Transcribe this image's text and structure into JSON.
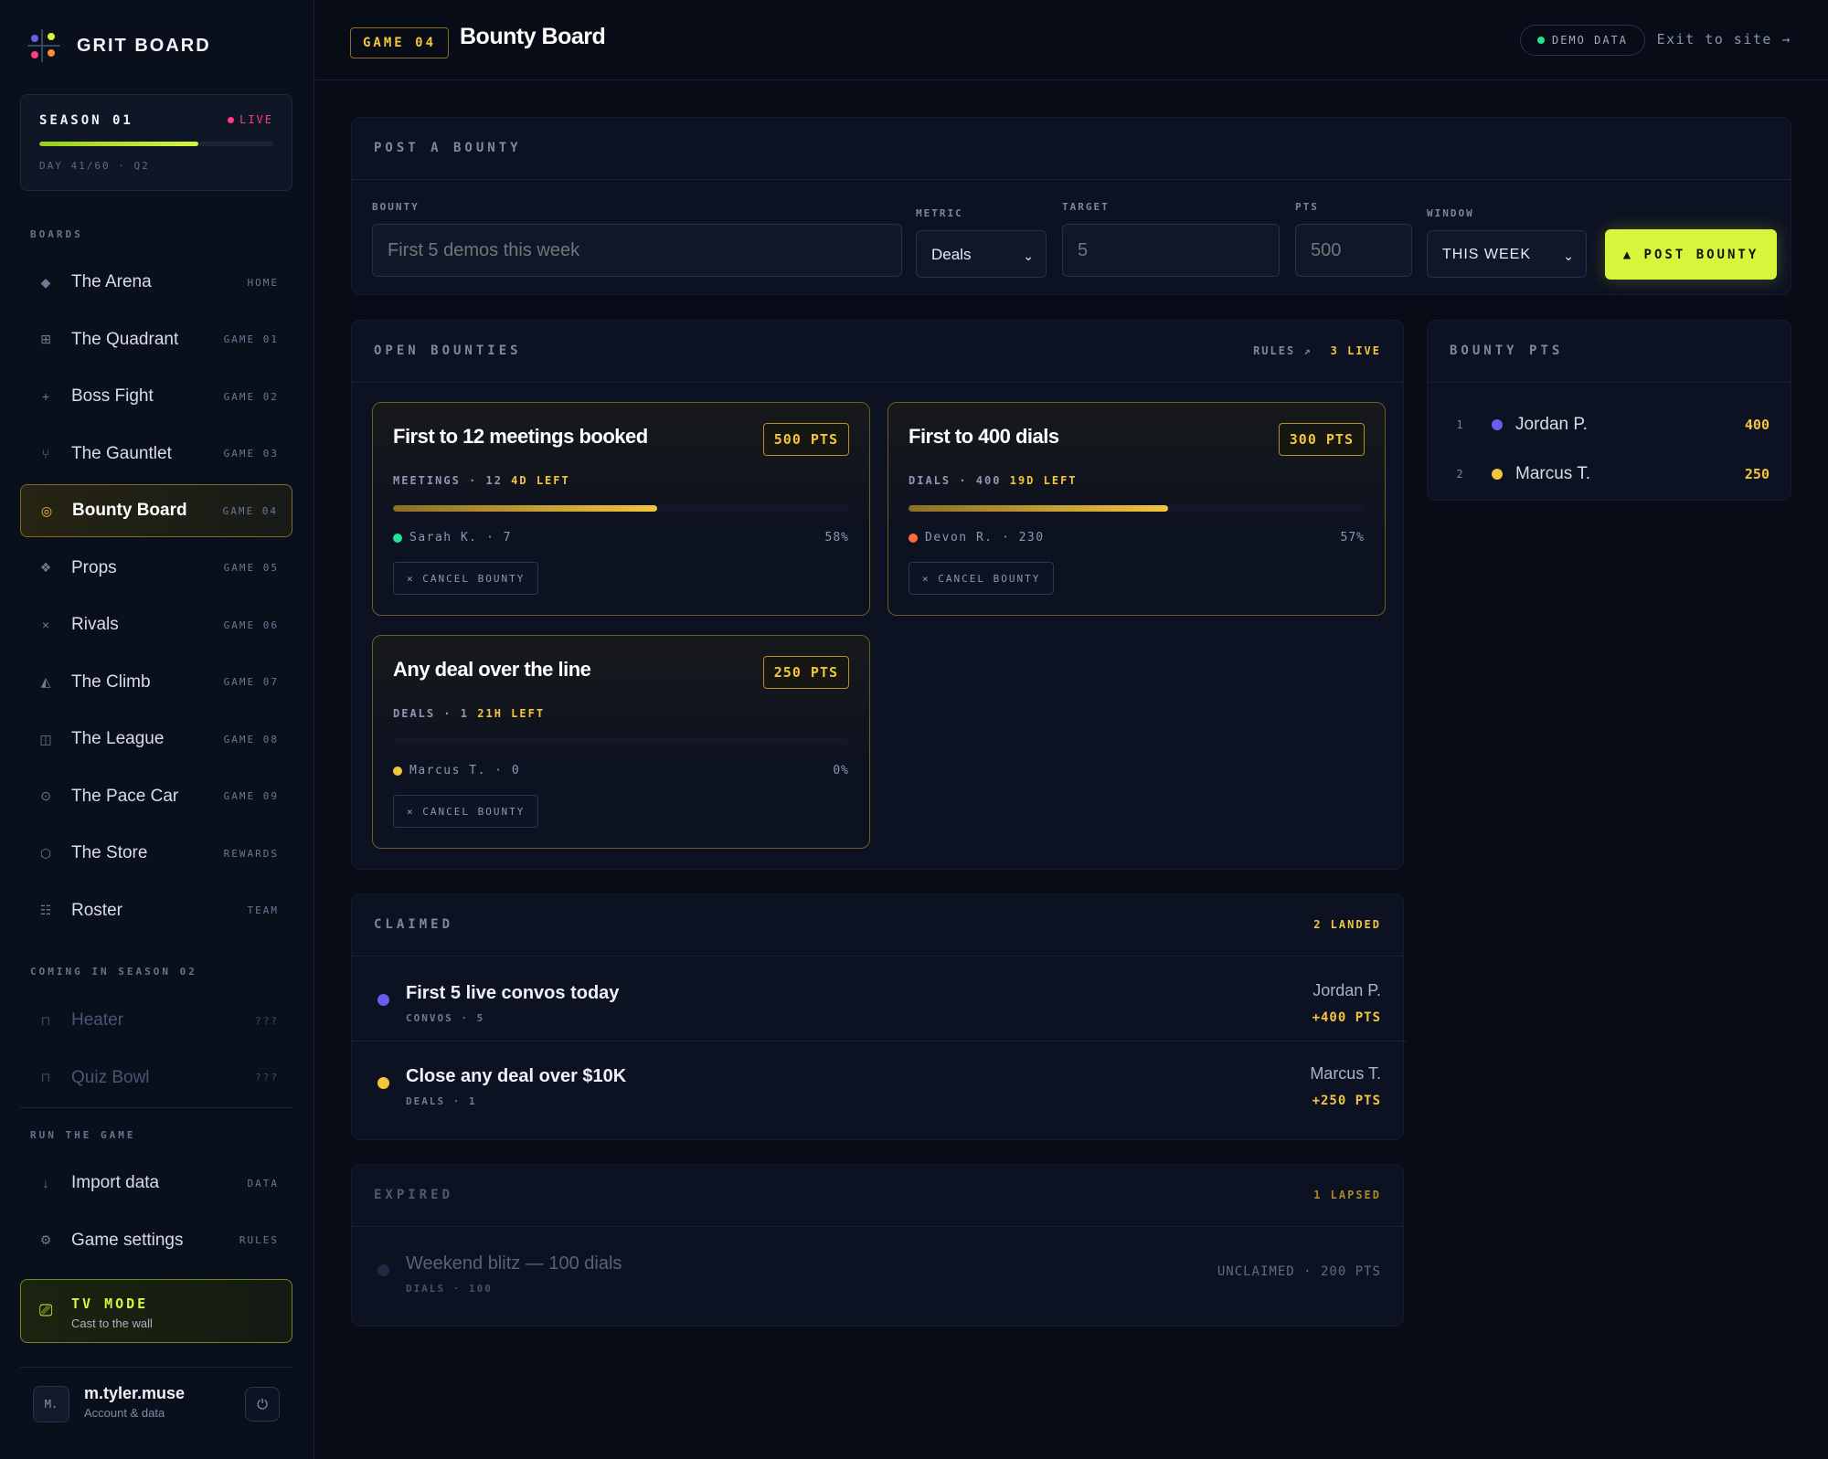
{
  "brand": {
    "name": "GRIT BOARD"
  },
  "season": {
    "title": "SEASON 01",
    "live_label": "LIVE",
    "progress": 0.68,
    "sub": "DAY 41/60 · Q2"
  },
  "sidebar": {
    "boards_label": "BOARDS",
    "items": [
      {
        "label": "The Arena",
        "tag": "HOME",
        "icon": "◆"
      },
      {
        "label": "The Quadrant",
        "tag": "GAME 01",
        "icon": "⊞"
      },
      {
        "label": "Boss Fight",
        "tag": "GAME 02",
        "icon": "+"
      },
      {
        "label": "The Gauntlet",
        "tag": "GAME 03",
        "icon": "⑂"
      },
      {
        "label": "Bounty Board",
        "tag": "GAME 04",
        "icon": "◎"
      },
      {
        "label": "Props",
        "tag": "GAME 05",
        "icon": "❖"
      },
      {
        "label": "Rivals",
        "tag": "GAME 06",
        "icon": "×"
      },
      {
        "label": "The Climb",
        "tag": "GAME 07",
        "icon": "◭"
      },
      {
        "label": "The League",
        "tag": "GAME 08",
        "icon": "◫"
      },
      {
        "label": "The Pace Car",
        "tag": "GAME 09",
        "icon": "⊙"
      },
      {
        "label": "The Store",
        "tag": "REWARDS",
        "icon": "⬡"
      },
      {
        "label": "Roster",
        "tag": "TEAM",
        "icon": "☷"
      }
    ],
    "coming_label": "COMING IN SEASON 02",
    "coming_items": [
      {
        "label": "Heater",
        "tag": "???",
        "icon": "⊓"
      },
      {
        "label": "Quiz Bowl",
        "tag": "???",
        "icon": "⊓"
      }
    ],
    "run_label": "RUN THE GAME",
    "run_items": [
      {
        "label": "Import data",
        "tag": "DATA",
        "icon": "↓"
      },
      {
        "label": "Game settings",
        "tag": "RULES",
        "icon": "⚙"
      }
    ],
    "tv": {
      "title": "TV MODE",
      "sub": "Cast to the wall",
      "icon": "⎚"
    },
    "user": {
      "initial": "M.",
      "name": "m.tyler.muse",
      "sub": "Account & data",
      "power_icon": "⏻"
    }
  },
  "topbar": {
    "game_chip": "GAME 04",
    "title": "Bounty Board",
    "demo": "DEMO DATA",
    "exit": "Exit to site →"
  },
  "post": {
    "title": "POST A BOUNTY",
    "bounty_label": "BOUNTY",
    "bounty_placeholder": "First 5 demos this week",
    "metric_label": "METRIC",
    "metric_value": "Deals",
    "target_label": "TARGET",
    "target_placeholder": "5",
    "pts_label": "PTS",
    "pts_placeholder": "500",
    "window_label": "WINDOW",
    "window_value": "THIS WEEK",
    "button": "▲ POST BOUNTY"
  },
  "open": {
    "title": "OPEN BOUNTIES",
    "rules": "RULES ↗",
    "live_count": "3 LIVE",
    "cards": [
      {
        "title": "First to 12 meetings booked",
        "pts": "500 PTS",
        "meta": "MEETINGS · 12",
        "left": "4D LEFT",
        "progress": 0.58,
        "leader": "Sarah K. · 7",
        "leader_color": "#28e08f",
        "pct": "58%",
        "cancel": "× CANCEL BOUNTY"
      },
      {
        "title": "First to 400 dials",
        "pts": "300 PTS",
        "meta": "DIALS · 400",
        "left": "19D LEFT",
        "progress": 0.57,
        "leader": "Devon R. · 230",
        "leader_color": "#ff6a3d",
        "pct": "57%",
        "cancel": "× CANCEL BOUNTY"
      },
      {
        "title": "Any deal over the line",
        "pts": "250 PTS",
        "meta": "DEALS · 1",
        "left": "21H LEFT",
        "progress": 0.0,
        "leader": "Marcus T. · 0",
        "leader_color": "#f2c53d",
        "pct": "0%",
        "cancel": "× CANCEL BOUNTY"
      }
    ]
  },
  "bounty_pts": {
    "title": "BOUNTY PTS",
    "rows": [
      {
        "rank": "1",
        "name": "Jordan P.",
        "pts": "400",
        "color": "#6b5cf0"
      },
      {
        "rank": "2",
        "name": "Marcus T.",
        "pts": "250",
        "color": "#f2c53d"
      }
    ]
  },
  "claimed": {
    "title": "CLAIMED",
    "count": "2 LANDED",
    "rows": [
      {
        "title": "First 5 live convos today",
        "meta": "CONVOS · 5",
        "who": "Jordan P.",
        "pts": "+400 PTS",
        "color": "#6b5cf0"
      },
      {
        "title": "Close any deal over $10K",
        "meta": "DEALS · 1",
        "who": "Marcus T.",
        "pts": "+250 PTS",
        "color": "#f2c53d"
      }
    ]
  },
  "expired": {
    "title": "EXPIRED",
    "count": "1 LAPSED",
    "rows": [
      {
        "title": "Weekend blitz — 100 dials",
        "meta": "DIALS · 100",
        "status": "UNCLAIMED · 200 PTS"
      }
    ]
  }
}
